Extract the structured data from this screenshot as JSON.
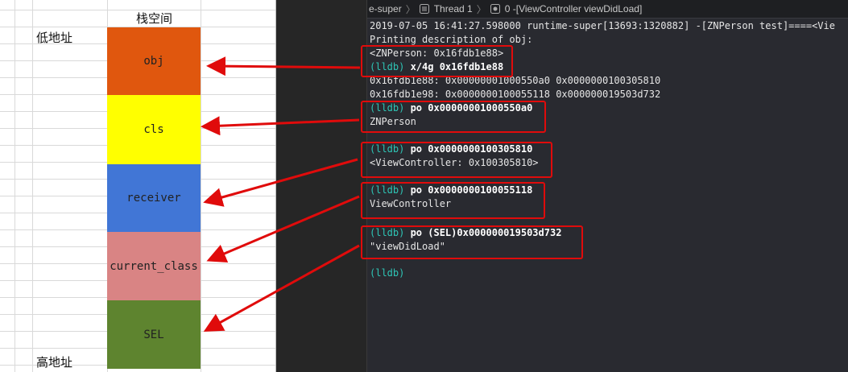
{
  "sheet": {
    "header": "栈空间",
    "low_address": "低地址",
    "high_address": "高地址",
    "blocks": [
      {
        "label": "obj",
        "color": "#e0570e"
      },
      {
        "label": "cls",
        "color": "#ffff00"
      },
      {
        "label": "receiver",
        "color": "#4176d6"
      },
      {
        "label": "current_class",
        "color": "#d98484"
      },
      {
        "label": "SEL",
        "color": "#5e842f"
      }
    ]
  },
  "jumpbar": {
    "target": "e-super",
    "thread": "Thread 1",
    "frame": "0 -[ViewController viewDidLoad]"
  },
  "console": {
    "lines": [
      {
        "text": "2019-07-05 16:41:27.598000 runtime-super[13693:1320882] -[ZNPerson test]====<Vie"
      },
      {
        "text": "Printing description of obj:"
      },
      {
        "text": "<ZNPerson: 0x16fdb1e88>"
      },
      {
        "prompt": "(lldb)",
        "cmd": " x/4g 0x16fdb1e88"
      },
      {
        "text": "0x16fdb1e88: 0x00000001000550a0 0x0000000100305810"
      },
      {
        "text": "0x16fdb1e98: 0x0000000100055118 0x000000019503d732"
      },
      {
        "prompt": "(lldb)",
        "cmd": " po 0x00000001000550a0"
      },
      {
        "text": "ZNPerson"
      },
      {
        "prompt": "(lldb)",
        "cmd": " po 0x0000000100305810"
      },
      {
        "text": "<ViewController: 0x100305810>"
      },
      {
        "prompt": "(lldb)",
        "cmd": " po 0x0000000100055118"
      },
      {
        "text": "ViewController"
      },
      {
        "prompt": "(lldb)",
        "cmd": " po (SEL)0x000000019503d732"
      },
      {
        "text": "\"viewDidLoad\""
      },
      {
        "prompt": "(lldb)",
        "cmd": ""
      }
    ]
  },
  "colors": {
    "annotation_red": "#e00b0b",
    "prompt_teal": "#2ec5b6",
    "console_bg": "#292a30"
  },
  "icons": [
    "thread-icon",
    "frame-icon"
  ]
}
